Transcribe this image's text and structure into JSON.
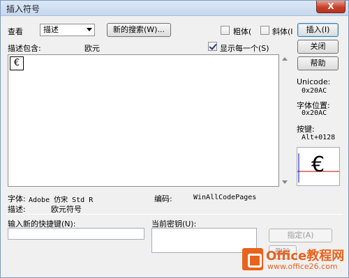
{
  "window": {
    "title": "插入符号",
    "close_label": "X"
  },
  "toolbar": {
    "view_label": "查看",
    "view_select_value": "描述",
    "new_search_label": "新的搜索(W)...",
    "bold_label": "粗体(",
    "bold_checked": false,
    "italic_label": "斜体(I",
    "italic_checked": false,
    "insert_label": "插入(I)"
  },
  "description_row": {
    "label": "描述包含:",
    "value": "欧元",
    "show_each_label": "显示每一个(S)",
    "show_each_checked": true
  },
  "buttons": {
    "close_label": "关闭",
    "help_label": "帮助",
    "assign_label": "指定(A)",
    "remove_label": "删除"
  },
  "char_grid": {
    "selected_char": "€"
  },
  "info_panel": {
    "unicode_label": "Unicode:",
    "unicode_value": "0x20AC",
    "font_position_label": "字体位置:",
    "font_position_value": "0x20AC",
    "keystroke_label": "按键:",
    "keystroke_value": "Alt+0128",
    "preview_char": "€"
  },
  "details": {
    "font_label": "字体:",
    "font_value": "Adobe 仿宋 Std R",
    "encoding_label": "编码:",
    "encoding_value": "WinAllCodePages",
    "description_label": "描述:",
    "description_value": "欧元符号"
  },
  "shortcut": {
    "new_shortcut_label": "输入新的快捷键(N):",
    "current_key_label": "当前密钥(U):"
  },
  "watermark": {
    "title": "Office教程网",
    "url": "www.office26.com"
  },
  "colors": {
    "accent": "#e8631d",
    "title_bar": "#dbe7f6",
    "close_button": "#c7402a"
  }
}
